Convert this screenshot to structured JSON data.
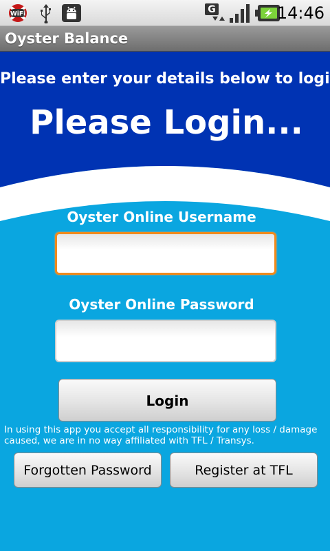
{
  "status_bar": {
    "time": "14:46",
    "icons": [
      "wifi-off-icon",
      "usb-icon",
      "android-debug-icon",
      "gprs-data-icon",
      "signal-strength-icon",
      "battery-charging-icon"
    ],
    "wifi_text": "WiFi",
    "data_text": "G"
  },
  "app": {
    "title": "Oyster Balance"
  },
  "header": {
    "subtitle": "Please enter your details below to login",
    "title": "Please Login..."
  },
  "form": {
    "username_label": "Oyster Online Username",
    "username_value": "",
    "password_label": "Oyster Online Password",
    "password_value": "",
    "login_label": "Login"
  },
  "disclaimer": "In using this app you accept all responsibility for any loss / damage caused, we are in no way affiliated with TFL / Transys.",
  "buttons": {
    "forgot_label": "Forgotten Password",
    "register_label": "Register at TFL"
  },
  "colors": {
    "header_blue": "#0033b3",
    "background_blue": "#0aa6e0",
    "focus_orange": "#f08a1c"
  }
}
